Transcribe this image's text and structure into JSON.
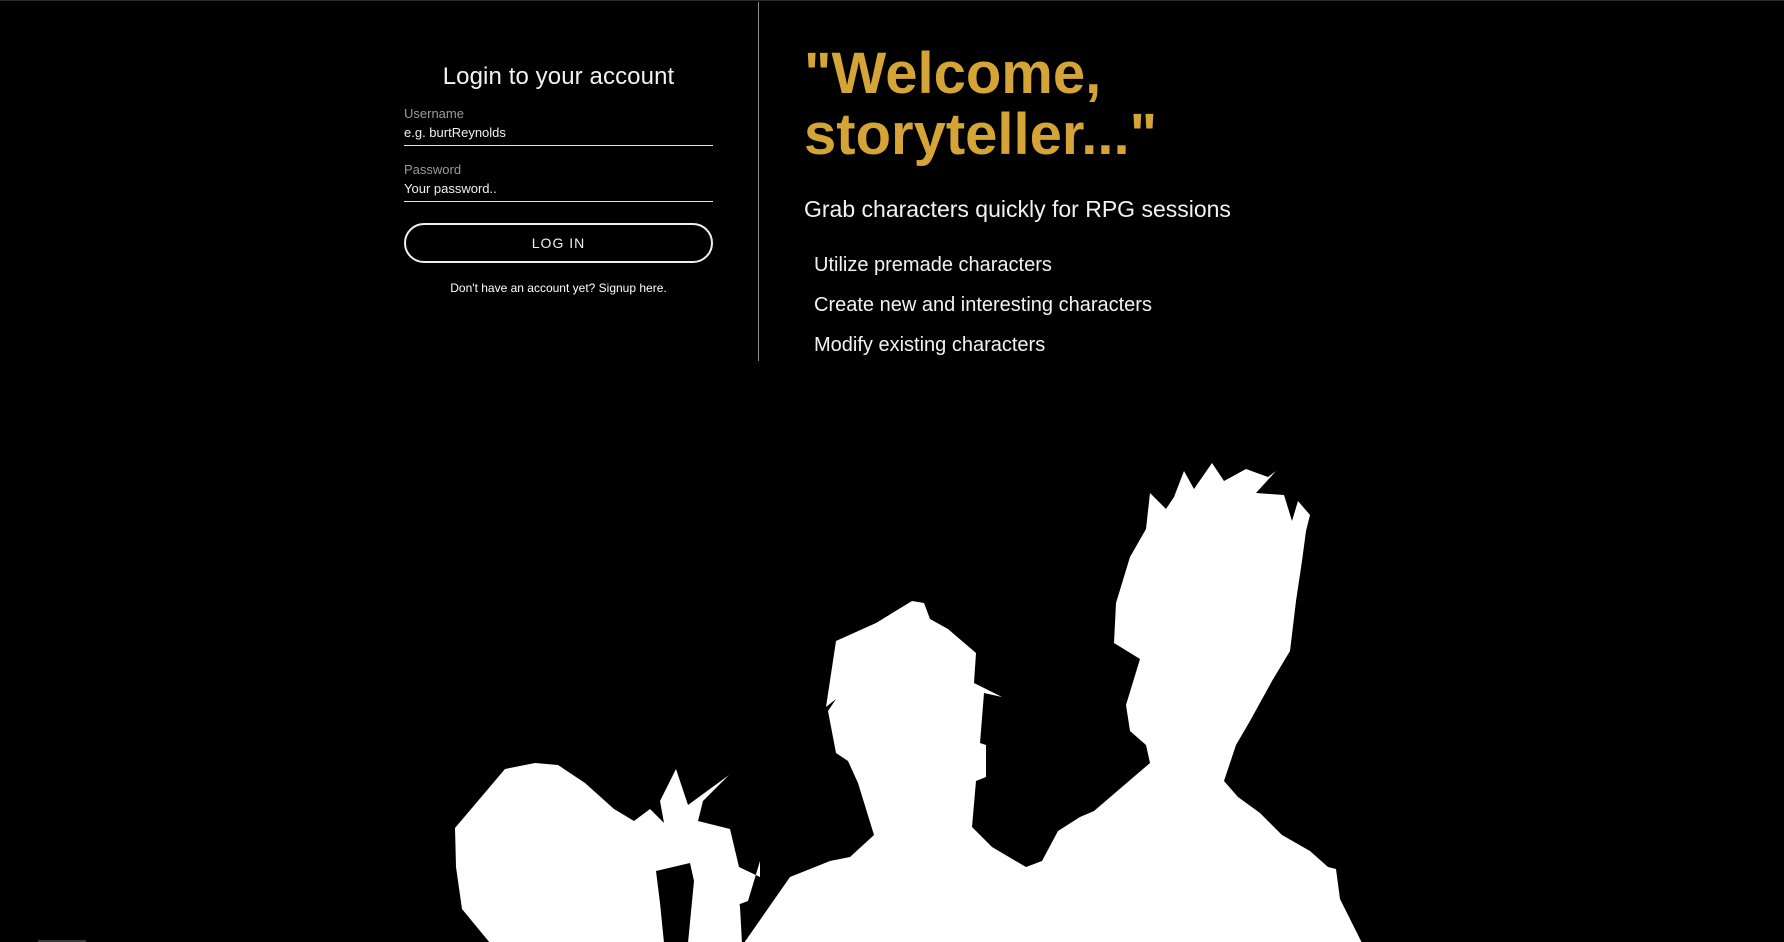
{
  "login": {
    "title": "Login to your account",
    "username_label": "Username",
    "username_placeholder": "e.g. burtReynolds",
    "password_label": "Password",
    "password_placeholder": "Your password..",
    "button_label": "LOG IN",
    "signup_text": "Don't have an account yet? Signup here."
  },
  "welcome": {
    "heading": "\"Welcome, storyteller...\"",
    "subheading": "Grab characters quickly for RPG sessions",
    "features": [
      "Utilize premade characters",
      "Create new and interesting characters",
      "Modify existing characters"
    ]
  },
  "colors": {
    "background": "#000000",
    "accent": "#d4a436",
    "text": "#f2f2f2",
    "silhouette": "#ffffff"
  },
  "icons": {
    "hero_art": "character-silhouettes-illustration"
  }
}
